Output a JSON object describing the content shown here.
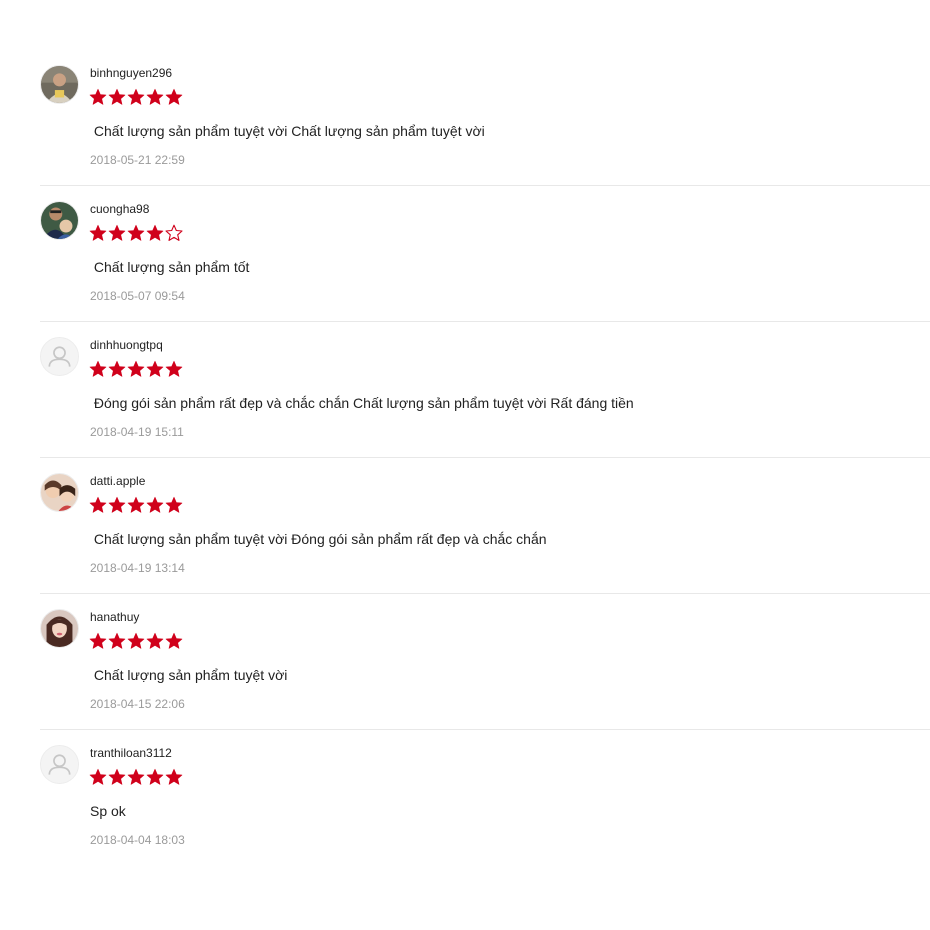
{
  "colors": {
    "star_filled": "#d0011b",
    "divider": "#e8e8e8",
    "username": "#222222",
    "comment": "#222222",
    "timestamp": "#9a9a9a"
  },
  "reviews": [
    {
      "username": "binhnguyen296",
      "avatar": "user-photo",
      "rating": 5,
      "max_rating": 5,
      "comment": " Chất lượng sản phẩm tuyệt vời Chất lượng sản phẩm tuyệt vời",
      "time": "2018-05-21 22:59"
    },
    {
      "username": "cuongha98",
      "avatar": "user-photo",
      "rating": 4,
      "max_rating": 5,
      "comment": " Chất lượng sản phẩm tốt",
      "time": "2018-05-07 09:54"
    },
    {
      "username": "dinhhuongtpq",
      "avatar": "default-user-icon",
      "rating": 5,
      "max_rating": 5,
      "comment": " Đóng gói sản phẩm rất đẹp và chắc chắn Chất lượng sản phẩm tuyệt vời Rất đáng tiền",
      "time": "2018-04-19 15:11"
    },
    {
      "username": "datti.apple",
      "avatar": "user-photo",
      "rating": 5,
      "max_rating": 5,
      "comment": " Chất lượng sản phẩm tuyệt vời Đóng gói sản phẩm rất đẹp và chắc chắn",
      "time": "2018-04-19 13:14"
    },
    {
      "username": "hanathuy",
      "avatar": "user-photo",
      "rating": 5,
      "max_rating": 5,
      "comment": " Chất lượng sản phẩm tuyệt vời",
      "time": "2018-04-15 22:06"
    },
    {
      "username": "tranthiloan3112",
      "avatar": "default-user-icon",
      "rating": 5,
      "max_rating": 5,
      "comment": "Sp ok",
      "time": "2018-04-04 18:03"
    }
  ]
}
